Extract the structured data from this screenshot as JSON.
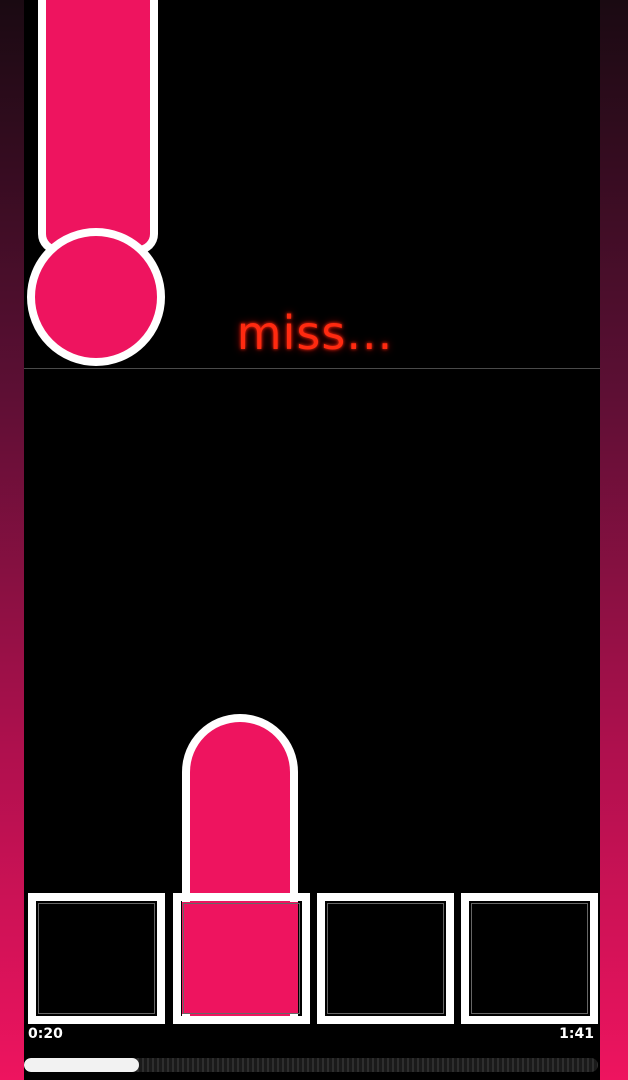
{
  "feedback": {
    "text": "miss..."
  },
  "time": {
    "elapsed": "0:20",
    "total": "1:41"
  },
  "progress": {
    "fraction": 0.2
  },
  "colors": {
    "note": "#ee145f",
    "miss_text": "#ff2a10",
    "pad_border": "#ffffff"
  },
  "lanes": [
    {
      "id": 1,
      "active": false,
      "note": "long-hold"
    },
    {
      "id": 2,
      "active": true,
      "note": "hold"
    },
    {
      "id": 3,
      "active": false,
      "note": "none"
    },
    {
      "id": 4,
      "active": false,
      "note": "none"
    }
  ]
}
